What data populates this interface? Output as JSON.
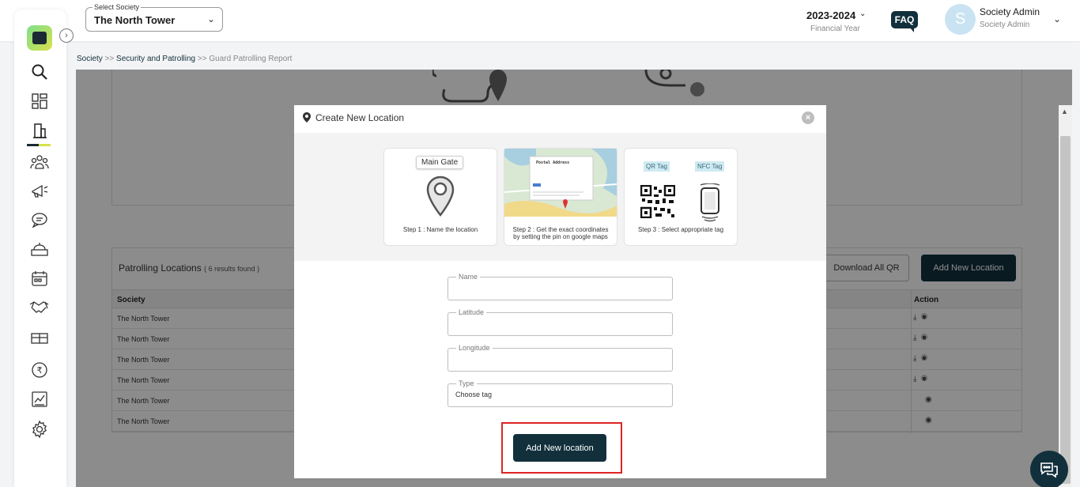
{
  "header": {
    "society_label": "Select Society",
    "society_value": "The North Tower",
    "financial_year": "2023-2024",
    "financial_year_label": "Financial Year",
    "faq": "FAQ",
    "avatar_letter": "S",
    "user_name": "Society Admin",
    "user_role": "Society Admin"
  },
  "breadcrumb": {
    "items": [
      "Society",
      "Security and Patrolling",
      "Guard Patrolling Report"
    ],
    "separator": ">>"
  },
  "table": {
    "title": "Patrolling Locations",
    "count": "( 6 results found )",
    "download_all_label": "Download All QR",
    "add_label": "Add New Location",
    "columns": [
      "Society",
      "Action"
    ],
    "rows": [
      {
        "society": "The North Tower",
        "download": true
      },
      {
        "society": "The North Tower",
        "download": true
      },
      {
        "society": "The North Tower",
        "download": true
      },
      {
        "society": "The North Tower",
        "download": true
      },
      {
        "society": "The North Tower",
        "download": false
      },
      {
        "society": "The North Tower",
        "download": false
      }
    ]
  },
  "modal": {
    "title": "Create New Location",
    "steps": {
      "step1_bubble": "Main Gate",
      "step1_caption": "Step 1 : Name the location",
      "step2_caption_line1": "Step 2 : Get the exact coordinates",
      "step2_caption_line2": "by setting the pin on google maps",
      "step2_map_title": "Postal Address",
      "step3_qr": "QR Tag",
      "step3_nfc": "NFC Tag",
      "step3_caption": "Step 3 : Select appropriate tag"
    },
    "fields": {
      "name_label": "Name",
      "name_value": "",
      "latitude_label": "Latitude",
      "latitude_value": "",
      "longitude_label": "Longitude",
      "longitude_value": "",
      "type_label": "Type",
      "type_value": "Choose tag"
    },
    "submit_label": "Add New location"
  },
  "colors": {
    "primary": "#12303c",
    "highlight": "#e02424",
    "accent_yellow": "#d9e04c"
  }
}
